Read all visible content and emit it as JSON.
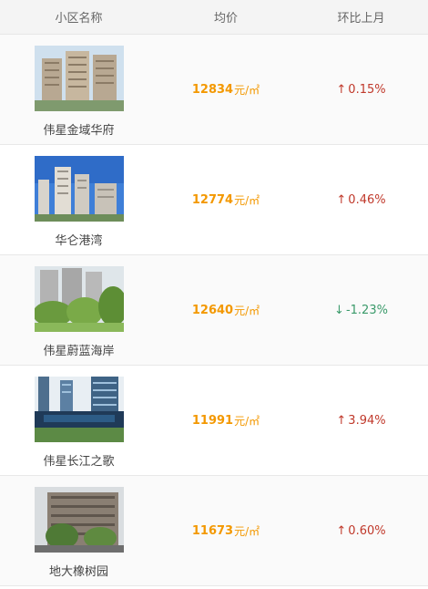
{
  "header": {
    "col_name": "小区名称",
    "col_price": "均价",
    "col_change": "环比上月"
  },
  "rows": [
    {
      "name": "伟星金域华府",
      "price": "12834",
      "unit": "元/㎡",
      "arrow": "↑",
      "change": "0.15%",
      "direction": "up"
    },
    {
      "name": "华仑港湾",
      "price": "12774",
      "unit": "元/㎡",
      "arrow": "↑",
      "change": "0.46%",
      "direction": "up"
    },
    {
      "name": "伟星蔚蓝海岸",
      "price": "12640",
      "unit": "元/㎡",
      "arrow": "↓",
      "change": "-1.23%",
      "direction": "down"
    },
    {
      "name": "伟星长江之歌",
      "price": "11991",
      "unit": "元/㎡",
      "arrow": "↑",
      "change": "3.94%",
      "direction": "up"
    },
    {
      "name": "地大橡树园",
      "price": "11673",
      "unit": "元/㎡",
      "arrow": "↑",
      "change": "0.60%",
      "direction": "up"
    }
  ],
  "colors": {
    "price": "#f39800",
    "up": "#c0392b",
    "down": "#3a9a6a"
  }
}
